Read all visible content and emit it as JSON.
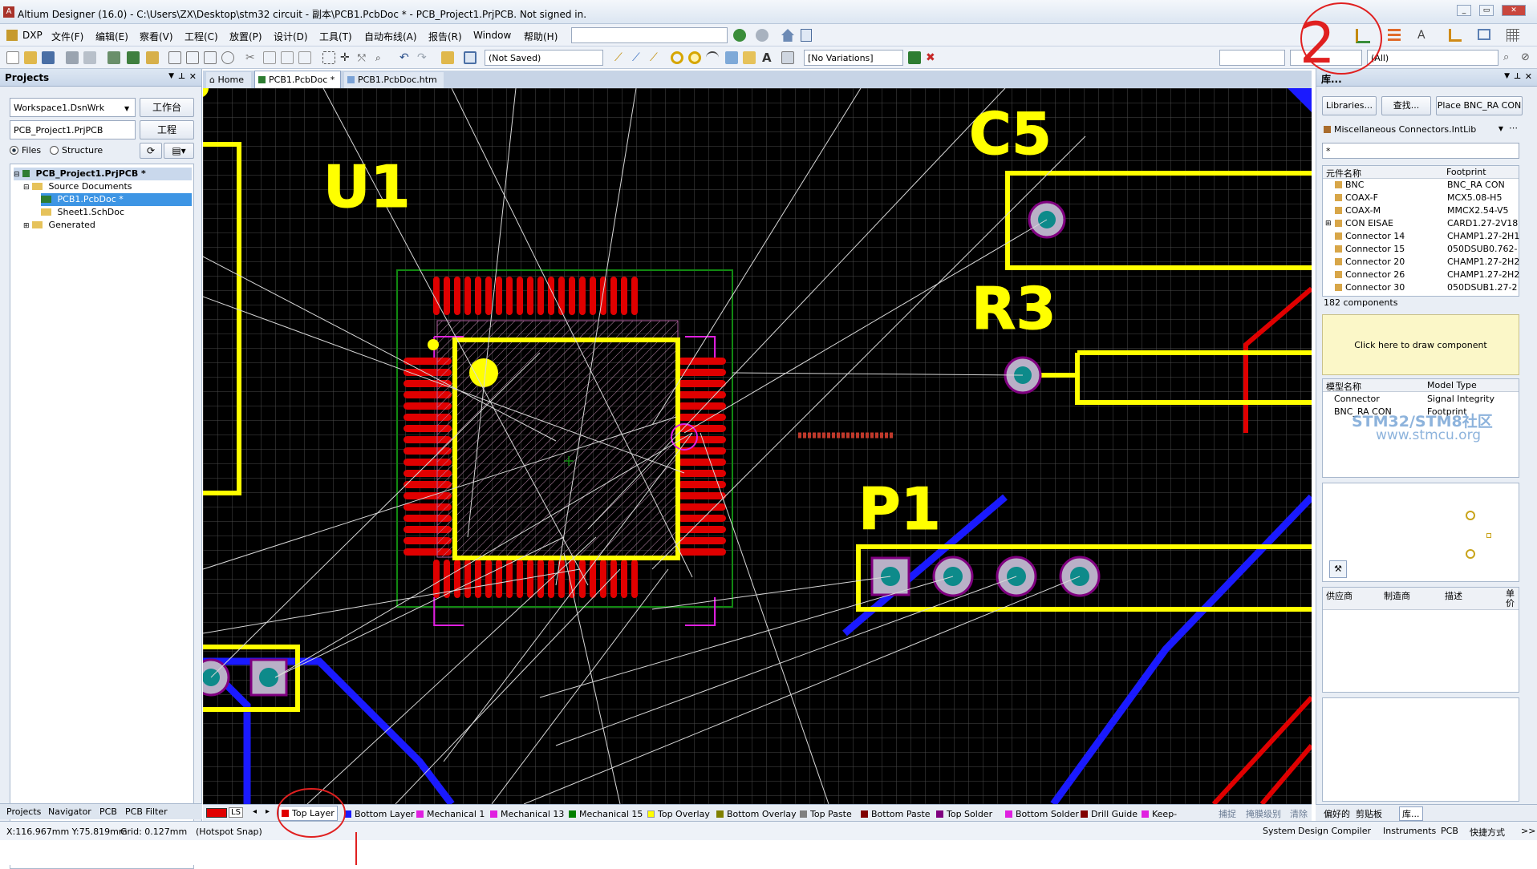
{
  "window": {
    "title": "Altium Designer (16.0) - C:\\Users\\ZX\\Desktop\\stm32 circuit - 副本\\PCB1.PcbDoc * - PCB_Project1.PrjPCB. Not signed in."
  },
  "menu": [
    "DXP",
    "文件(F)",
    "编辑(E)",
    "察看(V)",
    "工程(C)",
    "放置(P)",
    "设计(D)",
    "工具(T)",
    "自动布线(A)",
    "报告(R)",
    "Window",
    "帮助(H)"
  ],
  "toolbar": {
    "saved_state": "(Not Saved)",
    "variations": "[No Variations]",
    "filter_all": "(All)"
  },
  "projects_panel": {
    "title": "Projects",
    "workspace": "Workspace1.DsnWrk",
    "workspace_btn": "工作台",
    "project": "PCB_Project1.PrjPCB",
    "project_btn": "工程",
    "view_files": "Files",
    "view_structure": "Structure",
    "tree": [
      {
        "label": "PCB_Project1.PrjPCB *",
        "level": 0
      },
      {
        "label": "Source Documents",
        "level": 1
      },
      {
        "label": "PCB1.PcbDoc *",
        "level": 2
      },
      {
        "label": "Sheet1.SchDoc",
        "level": 2
      },
      {
        "label": "Generated",
        "level": 1
      }
    ],
    "bottom_tabs": [
      "Projects",
      "Navigator",
      "PCB",
      "PCB Filter"
    ]
  },
  "doc_tabs": [
    "Home",
    "PCB1.PcbDoc *",
    "PCB1.PcbDoc.htm"
  ],
  "pcb": {
    "designators": {
      "u1": "U1",
      "c5": "C5",
      "r3": "R3",
      "p1": "P1"
    }
  },
  "layer_tabs": [
    {
      "label": "Top Layer",
      "color": "#e00000"
    },
    {
      "label": "Bottom Layer",
      "color": "#1a1aff"
    },
    {
      "label": "Mechanical 1",
      "color": "#e020e0"
    },
    {
      "label": "Mechanical 13",
      "color": "#e020e0"
    },
    {
      "label": "Mechanical 15",
      "color": "#008000"
    },
    {
      "label": "Top Overlay",
      "color": "#ffff00"
    },
    {
      "label": "Bottom Overlay",
      "color": "#808000"
    },
    {
      "label": "Top Paste",
      "color": "#808080"
    },
    {
      "label": "Bottom Paste",
      "color": "#800000"
    },
    {
      "label": "Top Solder",
      "color": "#800080"
    },
    {
      "label": "Bottom Solder",
      "color": "#e020e0"
    },
    {
      "label": "Drill Guide",
      "color": "#800000"
    },
    {
      "label": "Keep-",
      "color": "#e020e0"
    }
  ],
  "layer_ls": "LS",
  "layer_extra": [
    "捕捉",
    "掩膜级别",
    "清除"
  ],
  "library_panel": {
    "title": "库...",
    "btn_libraries": "Libraries...",
    "btn_search": "查找...",
    "btn_place": "Place BNC_RA CON",
    "library": "Miscellaneous Connectors.IntLib",
    "filter": "*",
    "col_name": "元件名称",
    "col_footprint": "Footprint",
    "rows": [
      {
        "name": "BNC",
        "fp": "BNC_RA CON"
      },
      {
        "name": "COAX-F",
        "fp": "MCX5.08-H5"
      },
      {
        "name": "COAX-M",
        "fp": "MMCX2.54-V5"
      },
      {
        "name": "CON EISAE",
        "fp": "CARD1.27-2V18"
      },
      {
        "name": "Connector 14",
        "fp": "CHAMP1.27-2H1"
      },
      {
        "name": "Connector 15",
        "fp": "050DSUB0.762-"
      },
      {
        "name": "Connector 20",
        "fp": "CHAMP1.27-2H2"
      },
      {
        "name": "Connector 26",
        "fp": "CHAMP1.27-2H2"
      },
      {
        "name": "Connector 30",
        "fp": "050DSUB1.27-2"
      }
    ],
    "count": "182 components",
    "draw_hint": "Click here to draw component",
    "model_col_name": "模型名称",
    "model_col_type": "Model Type",
    "models": [
      {
        "name": "Connector",
        "type": "Signal Integrity"
      },
      {
        "name": "BNC_RA CON",
        "type": "Footprint"
      }
    ],
    "supplier_cols": [
      "供应商",
      "制造商",
      "描述",
      "单价"
    ],
    "bottom_tabs": [
      "偏好的",
      "剪贴板",
      "库..."
    ],
    "watermark1": "STM32/STM8社区",
    "watermark2": "www.stmcu.org"
  },
  "status": {
    "coords": "X:116.967mm Y:75.819mm",
    "grid": "Grid: 0.127mm",
    "snap": "(Hotspot Snap)",
    "right": [
      "System",
      "Design Compiler",
      "Instruments",
      "PCB",
      "快捷方式",
      ">>"
    ]
  },
  "annotation": {
    "mark": "2"
  }
}
